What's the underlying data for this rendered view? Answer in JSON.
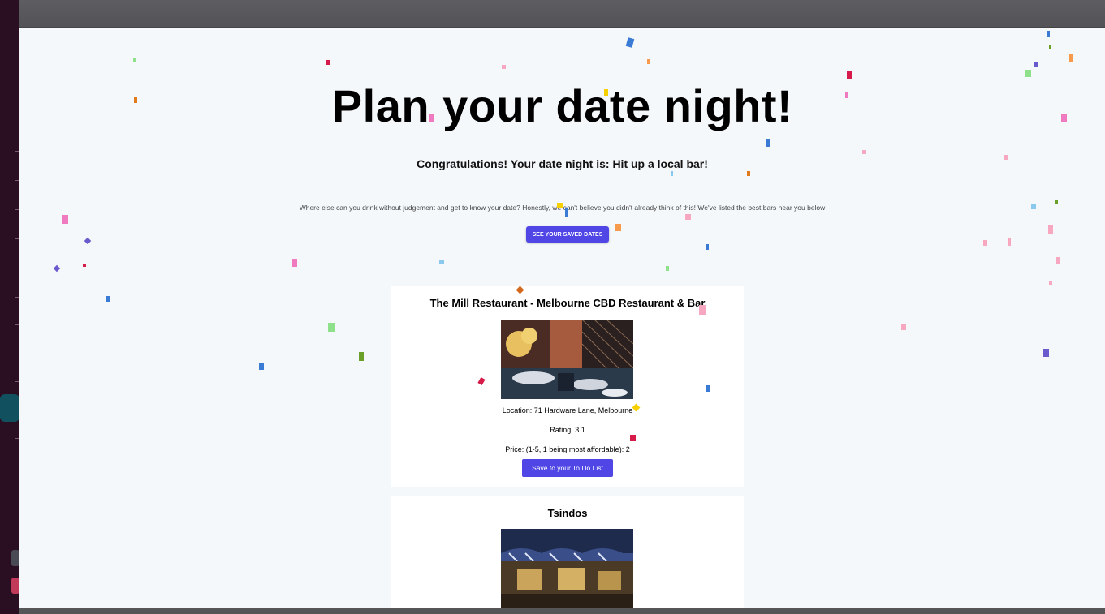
{
  "page": {
    "title": "Plan your date night!",
    "congrats": "Congratulations! Your date night is: Hit up a local bar!",
    "description": "Where else can you drink without judgement and get to know your date? Honestly, we can't believe you didn't already think of this! We've listed the best bars near you below",
    "saved_button": "SEE YOUR SAVED DATES"
  },
  "venues": [
    {
      "name": "The Mill Restaurant - Melbourne CBD Restaurant & Bar",
      "location": "Location: 71 Hardware Lane, Melbourne",
      "rating": "Rating: 3.1",
      "price": "Price: (1-5, 1 being most affordable): 2",
      "save_label": "Save to your To Do List"
    },
    {
      "name": "Tsindos"
    }
  ],
  "colors": {
    "accent": "#4f46e5",
    "background": "#f5f8fb"
  }
}
